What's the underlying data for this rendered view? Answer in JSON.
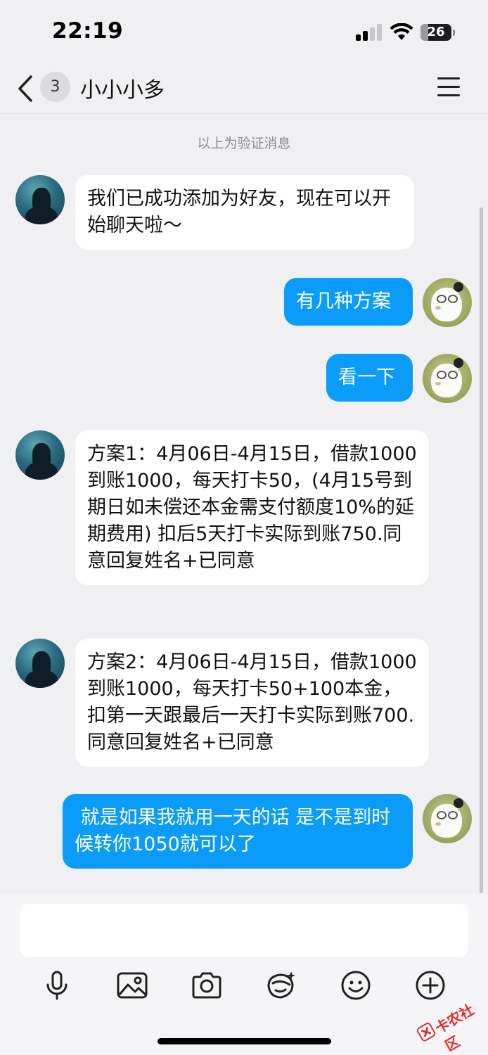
{
  "status_bar": {
    "time": "22:19",
    "battery": "26"
  },
  "header": {
    "unread_count": "3",
    "title": "小小小多"
  },
  "notice": "以上为验证消息",
  "messages": [
    {
      "side": "left",
      "text": "我们已成功添加为好友，现在可以开始聊天啦～"
    },
    {
      "side": "right",
      "text": "有几种方案"
    },
    {
      "side": "right",
      "text": "看一下"
    },
    {
      "side": "left",
      "text": "方案1：4月06日-4月15日，借款1000到账1000，每天打卡50，(4月15号到期日如未偿还本金需支付额度10%的延期费用) 扣后5天打卡实际到账750.同意回复姓名+已同意"
    },
    {
      "side": "left",
      "text": "方案2：4月06日-4月15日，借款1000到账1000，每天打卡50+100本金，扣第一天跟最后一天打卡实际到账700.同意回复姓名+已同意"
    },
    {
      "side": "right",
      "text": " 就是如果我就用一天的话 是不是到时候转你1050就可以了"
    }
  ],
  "toolbar": [
    "microphone-icon",
    "image-icon",
    "camera-icon",
    "sticker-icon",
    "emoji-icon",
    "plus-icon"
  ],
  "watermark": "卡农社区",
  "colors": {
    "outgoing_bubble": "#0a9cf8",
    "incoming_bubble": "#ffffff",
    "background": "#f0f0f2"
  }
}
